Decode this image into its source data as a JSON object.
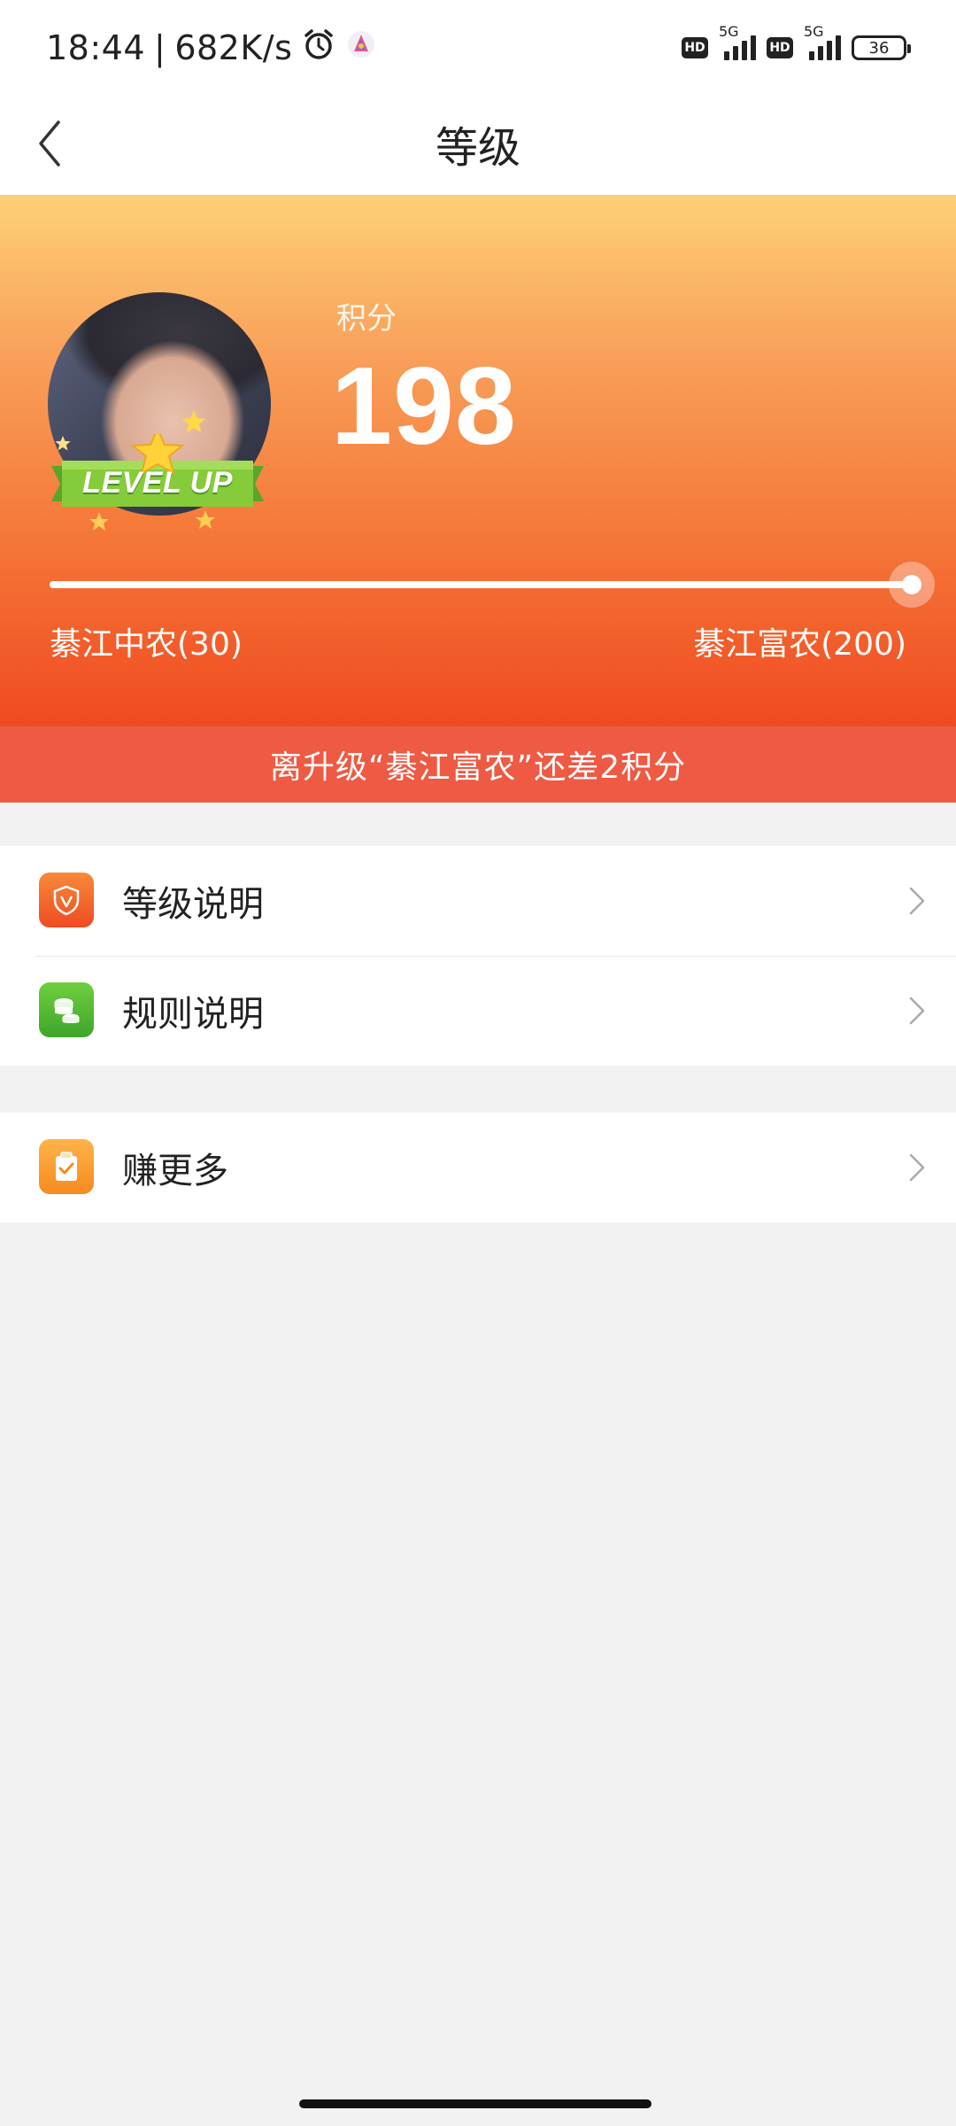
{
  "status_bar": {
    "time": "18:44",
    "net_speed": "682K/s",
    "sim1_hd": "HD",
    "sim1_network": "5G",
    "sim2_hd": "HD",
    "sim2_network": "5G",
    "battery": "36",
    "icons": [
      "alarm-icon",
      "app-notification-icon",
      "hd-icon",
      "signal-icon",
      "battery-icon"
    ]
  },
  "nav": {
    "title": "等级",
    "back_icon": "chevron-left-icon"
  },
  "hero": {
    "badge_text": "LEVEL UP",
    "points_label": "积分",
    "points_value": "198",
    "current_level": "綦江中农(30)",
    "next_level": "綦江富农(200)",
    "progress_fraction": 0.99,
    "upgrade_notice": "离升级“綦江富农”还差2积分"
  },
  "menu": {
    "group1": [
      {
        "label": "等级说明",
        "icon": "shield-v-icon",
        "color": "#f25c2b"
      },
      {
        "label": "规则说明",
        "icon": "coins-stack-icon",
        "color": "#4db336"
      }
    ],
    "group2": [
      {
        "label": "赚更多",
        "icon": "clipboard-check-icon",
        "color": "#f79a2c"
      }
    ]
  },
  "colors": {
    "hero_top": "#fdd176",
    "hero_bottom": "#f04a20",
    "notice_bar": "#ee5a43",
    "page_bg": "#f2f2f2"
  }
}
